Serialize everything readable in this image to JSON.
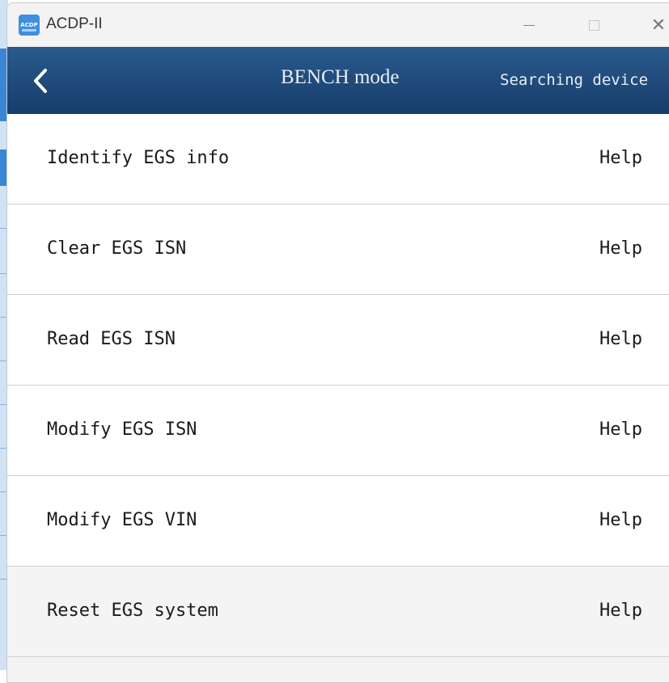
{
  "window": {
    "title": "ACDP-II",
    "icon_name": "acdp-app-icon",
    "icon_text": "ACDP",
    "controls": [
      "minimize-icon",
      "maximize-icon",
      "close-icon"
    ],
    "close_glyph": "✕"
  },
  "header": {
    "title": "BENCH mode",
    "status": "Searching device",
    "back_icon": "chevron-left-icon",
    "background": "#1f4c7e"
  },
  "menu": {
    "items": [
      {
        "label": "Identify EGS info",
        "help": "Help"
      },
      {
        "label": "Clear EGS ISN",
        "help": "Help"
      },
      {
        "label": "Read EGS ISN",
        "help": "Help"
      },
      {
        "label": "Modify EGS ISN",
        "help": "Help"
      },
      {
        "label": "Modify EGS VIN",
        "help": "Help"
      },
      {
        "label": "Reset EGS system",
        "help": "Help"
      }
    ]
  }
}
